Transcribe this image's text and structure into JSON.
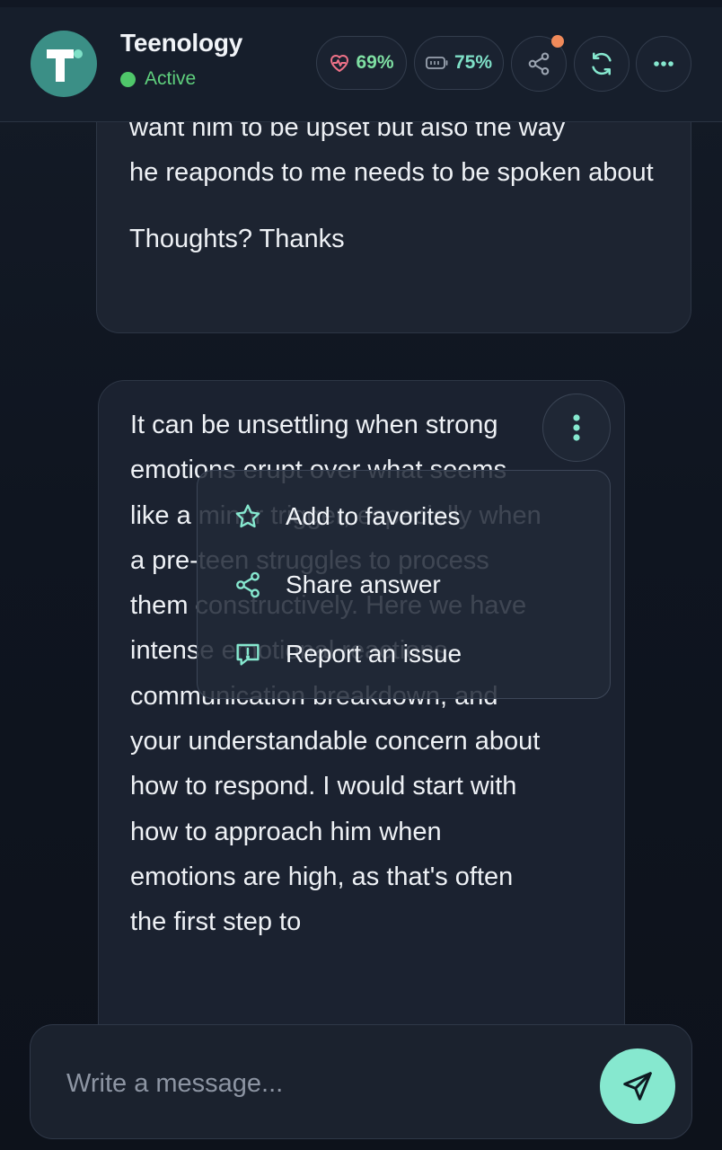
{
  "header": {
    "app_name": "Teenology",
    "avatar_letter": "T",
    "status": "Active",
    "health_percent": "69%",
    "battery_percent": "75%",
    "icons": {
      "health": "heart-pulse-icon",
      "battery": "battery-icon",
      "share": "share-icon",
      "refresh": "refresh-icon",
      "more": "more-horizontal-icon"
    }
  },
  "conversation": {
    "user_message": {
      "partial_top_line": "want him to be upset but also the way",
      "paragraph_1": "he reaponds to me needs to be spoken about",
      "paragraph_2": "Thoughts? Thanks"
    },
    "assistant_message": {
      "text": "It can be unsettling when strong emotions erupt over what seems like a minor trigger, especially when a pre-teen struggles to process them constructively. Here we have intense emotional reactions, communication breakdown, and your understandable concern about how to respond. I would start with how to approach him when emotions are high, as that's often the first step to"
    }
  },
  "context_menu": {
    "items": [
      {
        "label": "Add to favorites",
        "icon": "star-icon"
      },
      {
        "label": "Share answer",
        "icon": "share-icon"
      },
      {
        "label": "Report an issue",
        "icon": "report-icon"
      }
    ]
  },
  "composer": {
    "placeholder": "Write a message...",
    "send_icon": "send-icon"
  },
  "colors": {
    "accent": "#86e8cf",
    "status_green": "#5fd07d",
    "notification": "#f08a5a",
    "background": "#0f1520"
  }
}
